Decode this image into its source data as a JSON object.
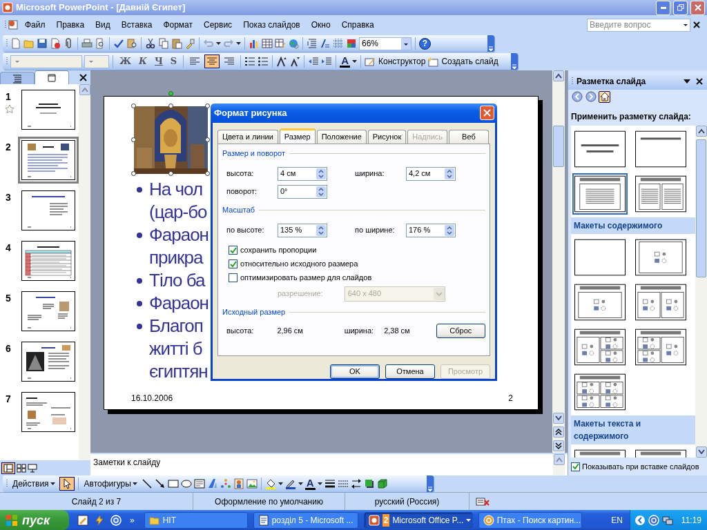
{
  "window": {
    "title": "Microsoft PowerPoint - [Давній Єгипет]"
  },
  "menu": [
    "Файл",
    "Правка",
    "Вид",
    "Вставка",
    "Формат",
    "Сервис",
    "Показ слайдов",
    "Окно",
    "Справка"
  ],
  "help_box": {
    "placeholder": "Введите вопрос"
  },
  "standard_toolbar": {
    "zoom": "66%",
    "help_button": "?"
  },
  "formatting_toolbar": {
    "style_buttons": [
      "Ж",
      "К",
      "Ч",
      "S"
    ],
    "align_buttons": [
      {
        "selected": false
      },
      {
        "selected": true
      },
      {
        "selected": false
      }
    ],
    "font_color_button": "A",
    "design_button": "Конструктор",
    "new_slide_button": "Создать слайд"
  },
  "outline_pane": {
    "tabs": [
      {
        "kind": "outline",
        "selected": false
      },
      {
        "kind": "slides",
        "selected": true
      }
    ],
    "slides": [
      {
        "number": "1",
        "kind": "title",
        "selected": false,
        "animated": true
      },
      {
        "number": "2",
        "kind": "two_pictures",
        "selected": true,
        "animated": false
      },
      {
        "number": "3",
        "kind": "text",
        "selected": false,
        "animated": false
      },
      {
        "number": "4",
        "kind": "table",
        "selected": false,
        "animated": false
      },
      {
        "number": "5",
        "kind": "picture_text",
        "selected": false,
        "animated": false
      },
      {
        "number": "6",
        "kind": "pyramid",
        "selected": false,
        "animated": false
      },
      {
        "number": "7",
        "kind": "title_pictures",
        "selected": false,
        "animated": false
      }
    ]
  },
  "slide": {
    "bullets": [
      {
        "lines": [
          "На чол",
          "(цар-бо"
        ]
      },
      {
        "lines": [
          "Фараон",
          "прикра"
        ]
      },
      {
        "lines": [
          "Тіло ба"
        ]
      },
      {
        "lines": [
          "Фараон"
        ]
      },
      {
        "lines": [
          "Благоп",
          "житті б",
          "єгиптян"
        ]
      }
    ],
    "date": "16.10.2006",
    "number": "2"
  },
  "dialog": {
    "title": "Формат рисунка",
    "tabs": [
      {
        "label": "Цвета и линии",
        "selected": false,
        "disabled": false
      },
      {
        "label": "Размер",
        "selected": true,
        "disabled": false
      },
      {
        "label": "Положение",
        "selected": false,
        "disabled": false
      },
      {
        "label": "Рисунок",
        "selected": false,
        "disabled": false
      },
      {
        "label": "Надпись",
        "selected": false,
        "disabled": true
      },
      {
        "label": "Веб",
        "selected": false,
        "disabled": false
      }
    ],
    "size_section": "Размер и поворот",
    "height": {
      "label": "высота:",
      "value": "4 см"
    },
    "width": {
      "label": "ширина:",
      "value": "4,2 см"
    },
    "rotation": {
      "label": "поворот:",
      "value": "0°"
    },
    "scale_section": "Масштаб",
    "scale_height": {
      "label": "по высоте:",
      "value": "135 %"
    },
    "scale_width": {
      "label": "по ширине:",
      "value": "176 %"
    },
    "checkboxes": [
      {
        "label": "сохранить пропорции",
        "checked": true
      },
      {
        "label": "относительно исходного размера",
        "checked": true
      },
      {
        "label": "оптимизировать размер для слайдов",
        "checked": false
      }
    ],
    "resolution": {
      "label": "разрешение:",
      "value": "640 x 480",
      "disabled": true
    },
    "original_section": "Исходный размер",
    "original_height": {
      "label": "высота:",
      "value": "2,96 см"
    },
    "original_width": {
      "label": "ширина:",
      "value": "2,38 см"
    },
    "reset_button": "Сброс",
    "buttons": [
      {
        "label": "OK",
        "disabled": false,
        "default": true
      },
      {
        "label": "Отмена",
        "disabled": false,
        "default": false
      },
      {
        "label": "Просмотр",
        "disabled": true,
        "default": false
      }
    ]
  },
  "task_pane": {
    "title": "Разметка слайда",
    "apply_label": "Применить разметку слайда:",
    "layout_groups": [
      {
        "layouts": [
          {
            "kind": "title",
            "selected": false
          },
          {
            "kind": "title_only",
            "selected": false
          },
          {
            "kind": "text",
            "selected": true
          },
          {
            "kind": "two_text",
            "selected": false
          }
        ]
      },
      {
        "heading": "Макеты содержимого",
        "layouts": [
          {
            "kind": "blank",
            "selected": false
          },
          {
            "kind": "content",
            "selected": false
          },
          {
            "kind": "title_content",
            "selected": false
          },
          {
            "kind": "title_two_content",
            "selected": false
          },
          {
            "kind": "title_content_two",
            "selected": false
          },
          {
            "kind": "title_two_two",
            "selected": false
          },
          {
            "kind": "title_four_content",
            "selected": false
          }
        ]
      },
      {
        "heading": "Макеты текста и содержимого",
        "layouts": [
          {
            "kind": "text_content",
            "selected": false
          },
          {
            "kind": "text_content",
            "selected": false
          }
        ]
      }
    ],
    "show_on_insert": {
      "label": "Показывать при вставке слайдов",
      "checked": true
    }
  },
  "notes": {
    "text": "Заметки к слайду"
  },
  "drawing_toolbar": {
    "actions_button": "Действия",
    "pointer_tool": {
      "selected": true
    },
    "autoshapes_button": "Автофигуры",
    "font_color_button": "A"
  },
  "status_bar": [
    "Слайд 2 из 7",
    "Оформление по умолчанию",
    "русский (Россия)"
  ],
  "taskbar": {
    "start": "пуск",
    "chevron": "»",
    "tasks": [
      {
        "label": "HIT",
        "kind": "folder",
        "selected": false
      },
      {
        "label": "розділ 5 - Microsoft ...",
        "kind": "document",
        "selected": false
      },
      {
        "count": "2",
        "label": "Microsoft Office P...",
        "kind": "presentation",
        "selected": true
      },
      {
        "label": "Птах - Поиск картин...",
        "kind": "browser",
        "selected": false
      }
    ],
    "language": "EN",
    "clock": "11:19"
  }
}
